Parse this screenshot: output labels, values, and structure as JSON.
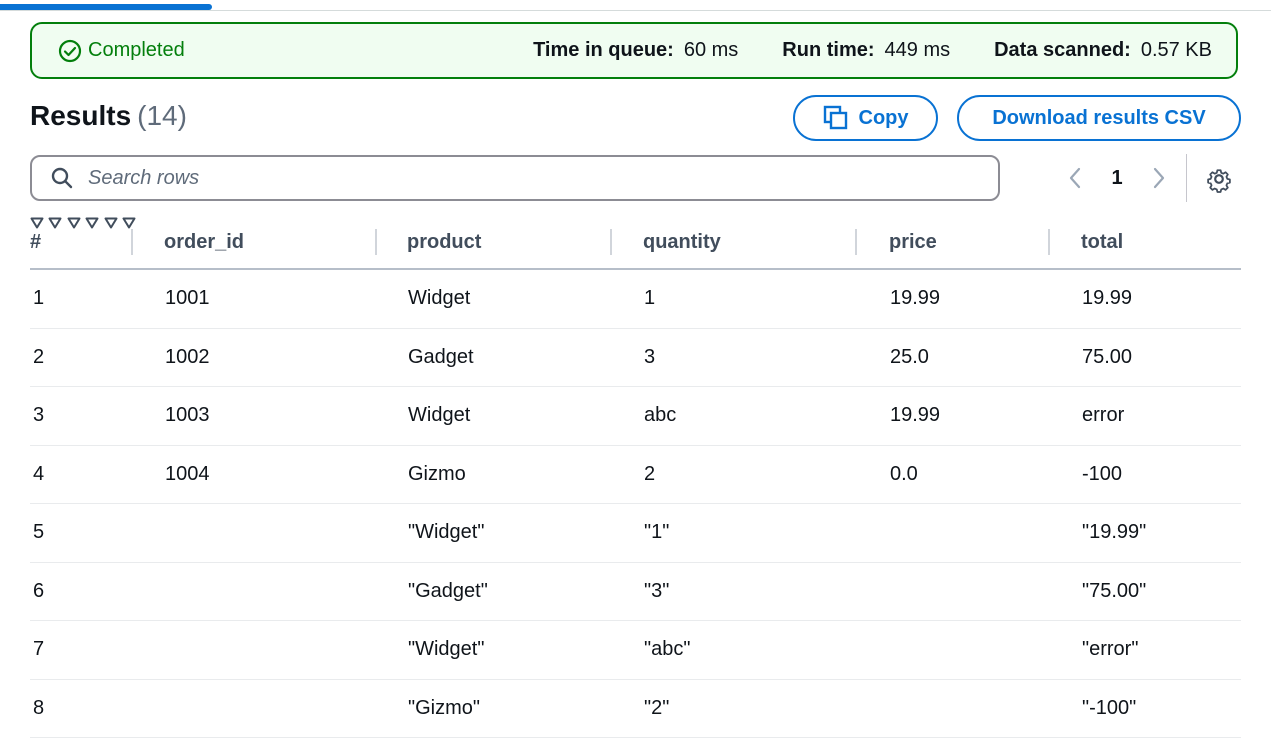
{
  "status": {
    "label": "Completed",
    "color": "#037f0c",
    "metrics": [
      {
        "label": "Time in queue:",
        "value": "60 ms"
      },
      {
        "label": "Run time:",
        "value": "449 ms"
      },
      {
        "label": "Data scanned:",
        "value": "0.57 KB"
      }
    ]
  },
  "results": {
    "title": "Results",
    "count": "(14)"
  },
  "toolbar": {
    "copy_label": "Copy",
    "download_label": "Download results CSV"
  },
  "search": {
    "placeholder": "Search rows",
    "value": ""
  },
  "pagination": {
    "current_page": "1"
  },
  "table": {
    "columns": [
      "#",
      "order_id",
      "product",
      "quantity",
      "price",
      "total"
    ],
    "rows": [
      [
        "1",
        "1001",
        "Widget",
        "1",
        "19.99",
        "19.99"
      ],
      [
        "2",
        "1002",
        "Gadget",
        "3",
        "25.0",
        "75.00"
      ],
      [
        "3",
        "1003",
        "Widget",
        "abc",
        "19.99",
        "error"
      ],
      [
        "4",
        "1004",
        "Gizmo",
        "2",
        "0.0",
        "-100"
      ],
      [
        "5",
        "",
        "\"Widget\"",
        "\"1\"",
        "",
        "\"19.99\""
      ],
      [
        "6",
        "",
        "\"Gadget\"",
        "\"3\"",
        "",
        "\"75.00\""
      ],
      [
        "7",
        "",
        "\"Widget\"",
        "\"abc\"",
        "",
        "\"error\""
      ],
      [
        "8",
        "",
        "\"Gizmo\"",
        "\"2\"",
        "",
        "\"-100\""
      ]
    ]
  },
  "icons": {
    "status": "check-circle-icon",
    "copy": "copy-icon",
    "search": "search-icon",
    "prev": "chevron-left-icon",
    "next": "chevron-right-icon",
    "settings": "gear-icon",
    "sort": "caret-down-icon"
  },
  "colors": {
    "accent": "#0972d3",
    "success": "#037f0c",
    "success_bg": "#f0fdf1"
  }
}
